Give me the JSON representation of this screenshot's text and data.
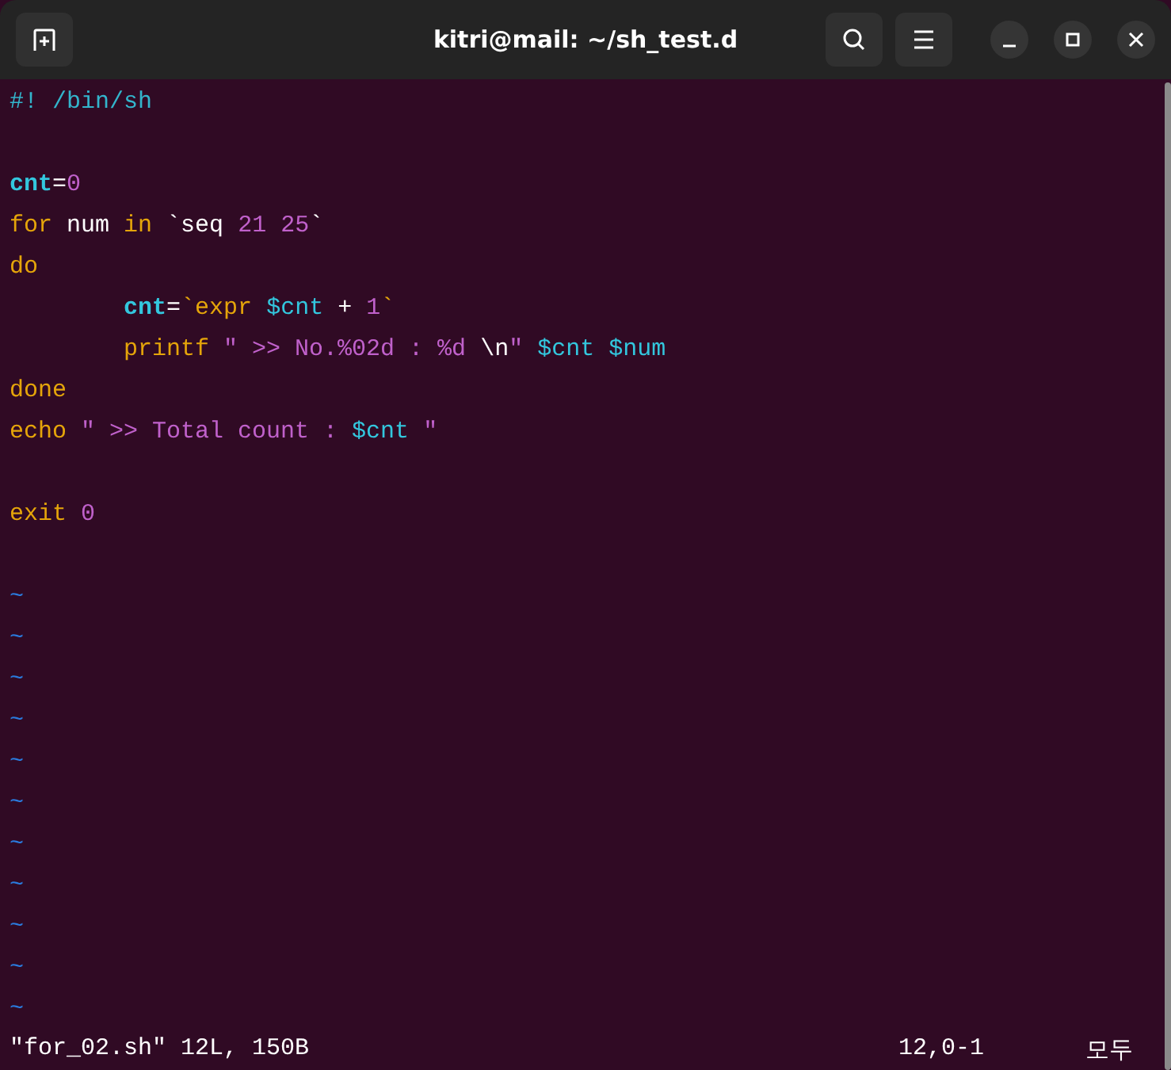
{
  "window": {
    "title": "kitri@mail: ~/sh_test.d"
  },
  "editor": {
    "lines": [
      {
        "kind": "code",
        "tokens": [
          {
            "text": "#! /bin/sh",
            "kind": "comment"
          }
        ]
      },
      {
        "kind": "blank"
      },
      {
        "kind": "code",
        "tokens": [
          {
            "text": "cnt",
            "kind": "variable"
          },
          {
            "text": "=",
            "kind": "plain"
          },
          {
            "text": "0",
            "kind": "number"
          }
        ]
      },
      {
        "kind": "code",
        "tokens": [
          {
            "text": "for",
            "kind": "keyword"
          },
          {
            "text": " num ",
            "kind": "plain"
          },
          {
            "text": "in",
            "kind": "keyword"
          },
          {
            "text": " `seq ",
            "kind": "plain"
          },
          {
            "text": "21",
            "kind": "number"
          },
          {
            "text": " 25",
            "kind": "number"
          },
          {
            "text": "`",
            "kind": "plain"
          }
        ]
      },
      {
        "kind": "code",
        "tokens": [
          {
            "text": "do",
            "kind": "keyword"
          }
        ]
      },
      {
        "kind": "code",
        "tokens": [
          {
            "text": "        cnt",
            "kind": "variable"
          },
          {
            "text": "=",
            "kind": "plain"
          },
          {
            "text": "`expr",
            "kind": "keyword"
          },
          {
            "text": " $cnt",
            "kind": "reference"
          },
          {
            "text": " + ",
            "kind": "plain"
          },
          {
            "text": "1",
            "kind": "number"
          },
          {
            "text": "`",
            "kind": "keyword"
          }
        ]
      },
      {
        "kind": "code",
        "tokens": [
          {
            "text": "        printf",
            "kind": "keyword"
          },
          {
            "text": " \" >> No.%02d : %d ",
            "kind": "string"
          },
          {
            "text": "\\n",
            "kind": "plain"
          },
          {
            "text": "\"",
            "kind": "string"
          },
          {
            "text": " $cnt $num",
            "kind": "reference"
          }
        ]
      },
      {
        "kind": "code",
        "tokens": [
          {
            "text": "done",
            "kind": "keyword"
          }
        ]
      },
      {
        "kind": "code",
        "tokens": [
          {
            "text": "echo",
            "kind": "keyword"
          },
          {
            "text": " \" >> Total count : ",
            "kind": "string"
          },
          {
            "text": "$cnt",
            "kind": "reference"
          },
          {
            "text": " \"",
            "kind": "string"
          }
        ]
      },
      {
        "kind": "blank"
      },
      {
        "kind": "code",
        "tokens": [
          {
            "text": "exit",
            "kind": "keyword"
          },
          {
            "text": " 0",
            "kind": "number"
          }
        ]
      },
      {
        "kind": "blank"
      },
      {
        "kind": "filler",
        "text": "~"
      },
      {
        "kind": "filler",
        "text": "~"
      },
      {
        "kind": "filler",
        "text": "~"
      },
      {
        "kind": "filler",
        "text": "~"
      },
      {
        "kind": "filler",
        "text": "~"
      },
      {
        "kind": "filler",
        "text": "~"
      },
      {
        "kind": "filler",
        "text": "~"
      },
      {
        "kind": "filler",
        "text": "~"
      },
      {
        "kind": "filler",
        "text": "~"
      },
      {
        "kind": "filler",
        "text": "~"
      },
      {
        "kind": "filler",
        "text": "~"
      }
    ]
  },
  "status_bar": {
    "message": "\"for_02.sh\" 12L, 150B",
    "position": "12,0-1",
    "scroll": "모두"
  }
}
